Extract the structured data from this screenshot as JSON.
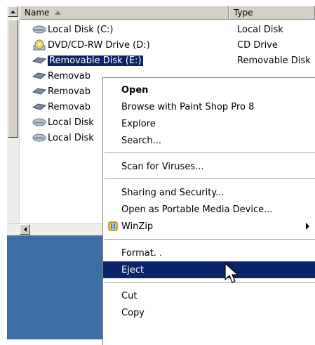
{
  "header": {
    "name_label": "Name",
    "type_label": "Type"
  },
  "rows": [
    {
      "name": "Local Disk (C:)",
      "type": "Local Disk",
      "icon": "local-disk-icon"
    },
    {
      "name": "DVD/CD-RW Drive (D:)",
      "type": "CD Drive",
      "icon": "cd-drive-icon"
    },
    {
      "name": "Removable Disk (E:)",
      "type": "Removable Disk",
      "icon": "removable-disk-icon",
      "selected": true
    },
    {
      "name": "Removab",
      "type": "",
      "icon": "removable-disk-icon"
    },
    {
      "name": "Removab",
      "type": "",
      "icon": "removable-disk-icon"
    },
    {
      "name": "Removab",
      "type": "",
      "icon": "removable-disk-icon"
    },
    {
      "name": "Local Disk",
      "type": "",
      "icon": "local-disk-icon"
    },
    {
      "name": "Local Disk",
      "type": "",
      "icon": "local-disk-icon"
    }
  ],
  "context_menu": {
    "open": "Open",
    "browse": "Browse with Paint Shop Pro 8",
    "explore": "Explore",
    "search": "Search...",
    "scan": "Scan for Viruses...",
    "sharing": "Sharing and Security...",
    "portable": "Open as Portable Media Device...",
    "winzip": "WinZip",
    "format": "Format. .",
    "eject": "Eject",
    "cut": "Cut",
    "copy": "Copy"
  },
  "colors": {
    "selection": "#0a246a",
    "desktop": "#3a6ea5"
  }
}
